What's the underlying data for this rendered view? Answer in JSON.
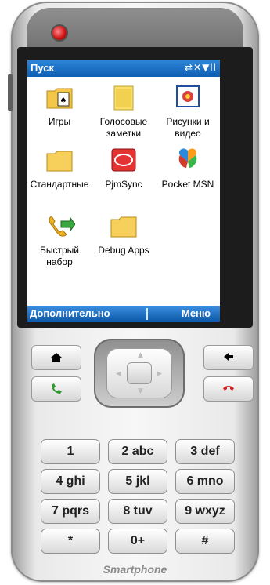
{
  "screen": {
    "title": "Пуск",
    "status_text": "⇄✕▼ll",
    "items": [
      {
        "label": "Игры",
        "icon": "games-folder-icon"
      },
      {
        "label": "Голосовые заметки",
        "icon": "voice-notes-icon"
      },
      {
        "label": "Рисунки и видео",
        "icon": "pictures-video-icon"
      },
      {
        "label": "Стандартные",
        "icon": "folder-icon"
      },
      {
        "label": "PjmSync",
        "icon": "pjmsync-icon"
      },
      {
        "label": "Pocket MSN",
        "icon": "pocket-msn-icon"
      },
      {
        "label": "Быстрый набор",
        "icon": "speed-dial-icon"
      },
      {
        "label": "Debug Apps",
        "icon": "folder-icon"
      }
    ],
    "soft_left": "Дополнительно",
    "soft_right": "Меню"
  },
  "keys": [
    {
      "label": "1"
    },
    {
      "label": "2 abc"
    },
    {
      "label": "3 def"
    },
    {
      "label": "4 ghi"
    },
    {
      "label": "5 jkl"
    },
    {
      "label": "6 mno"
    },
    {
      "label": "7 pqrs"
    },
    {
      "label": "8 tuv"
    },
    {
      "label": "9 wxyz"
    },
    {
      "label": "*"
    },
    {
      "label": "0+"
    },
    {
      "label": "#"
    }
  ],
  "brand": "Smartphone",
  "colors": {
    "accent": "#1f74c9",
    "call_green": "#2f9a2f",
    "end_red": "#d02020"
  }
}
